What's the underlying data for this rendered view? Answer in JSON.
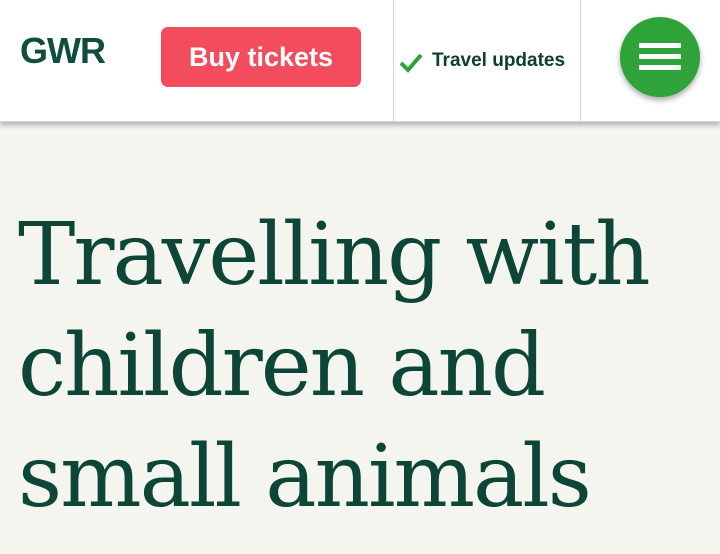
{
  "header": {
    "logo_text": "GWR",
    "buy_tickets_label": "Buy tickets",
    "travel_updates_label": "Travel updates",
    "check_icon": "check-icon",
    "menu_icon": "hamburger-menu-icon"
  },
  "main": {
    "title": "Travelling with children and small animals"
  },
  "colors": {
    "brand_green": "#0f4d3c",
    "buy_button": "#f24c5d",
    "menu_button": "#2fa33a",
    "check": "#2fa33a",
    "background": "#f5f5ef"
  }
}
